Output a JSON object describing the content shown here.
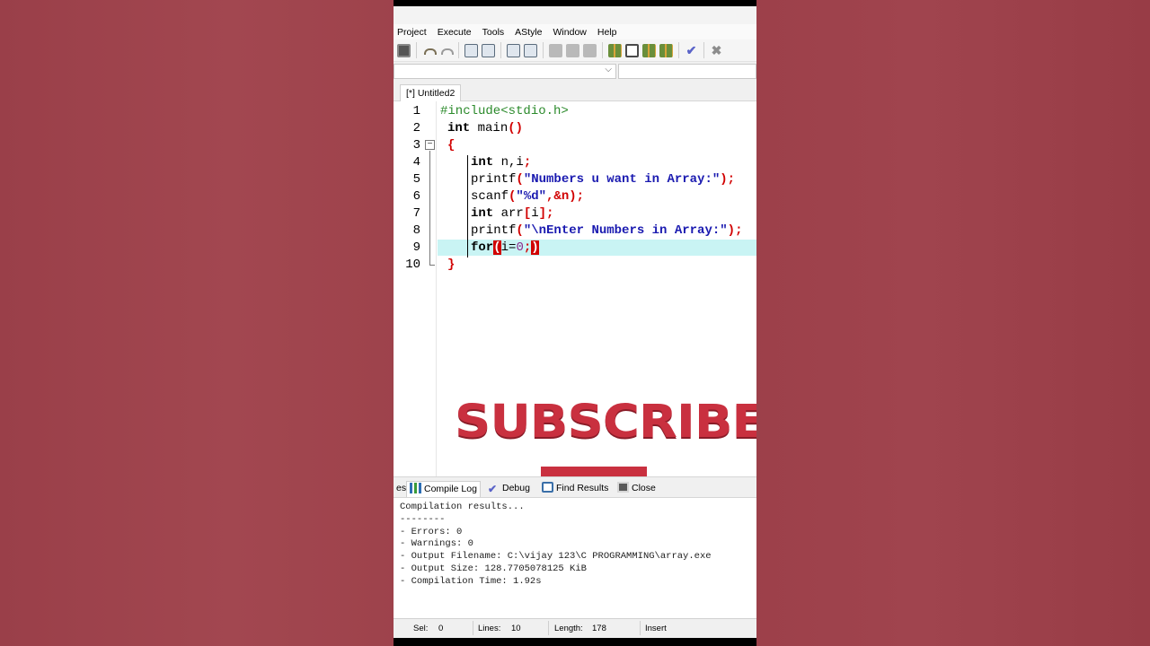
{
  "menu": [
    "Project",
    "Execute",
    "Tools",
    "AStyle",
    "Window",
    "Help"
  ],
  "tab": {
    "label": "[*] Untitled2"
  },
  "editor": {
    "line_numbers": [
      "1",
      "2",
      "3",
      "4",
      "5",
      "6",
      "7",
      "8",
      "9",
      "10"
    ],
    "current_line": 9,
    "code": {
      "l1": "#include<stdio.h>",
      "l2_kw": "int",
      "l2_rest": " main",
      "l2_paren": "()",
      "l3": "{",
      "l4_kw": "int",
      "l4_rest": " n,i",
      "l4_semi": ";",
      "l5_fn": "printf",
      "l5_open": "(",
      "l5_str": "\"Numbers u want in Array:\"",
      "l5_close": ");",
      "l6_fn": "scanf",
      "l6_open": "(",
      "l6_str": "\"%d\"",
      "l6_mid": ",&n",
      "l6_close": ");",
      "l7_kw": "int",
      "l7_rest": " arr",
      "l7_ob": "[",
      "l7_i": "i",
      "l7_cb": "];",
      "l8_fn": "printf",
      "l8_open": "(",
      "l8_str": "\"\\nEnter Numbers in Array:\"",
      "l8_close": ");",
      "l9_kw": "for",
      "l9_open": "(",
      "l9_mid": "i=",
      "l9_num": "0",
      "l9_semi": ";",
      "l9_close": ")",
      "l10": "}"
    }
  },
  "overlay": {
    "subscribe": "SUBSCRIBE"
  },
  "bottom_tabs": {
    "partial": "es",
    "compile_log": "Compile Log",
    "debug": "Debug",
    "find_results": "Find Results",
    "close": "Close"
  },
  "log": [
    "Compilation results...",
    "--------",
    "- Errors: 0",
    "- Warnings: 0",
    "- Output Filename: C:\\vijay 123\\C PROGRAMMING\\array.exe",
    "- Output Size: 128.7705078125 KiB",
    "- Compilation Time: 1.92s"
  ],
  "status": {
    "sel_label": "Sel:",
    "sel_value": "0",
    "lines_label": "Lines:",
    "lines_value": "10",
    "length_label": "Length:",
    "length_value": "178",
    "mode": "Insert"
  },
  "colors": {
    "accent": "#c9303f",
    "line_highlight": "#c9f4f4",
    "background": "#9a3f49"
  }
}
